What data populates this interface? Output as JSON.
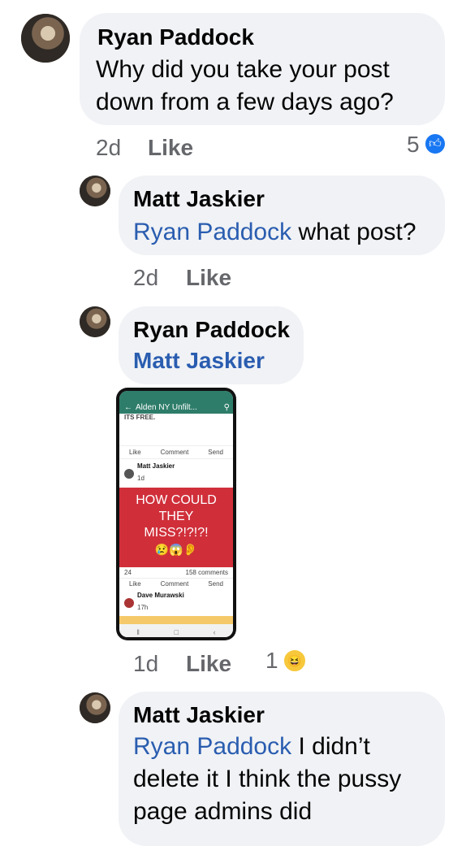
{
  "comments": [
    {
      "author": "Ryan Paddock",
      "text": "Why did you take your post down from a few days ago?",
      "age": "2d",
      "like_label": "Like",
      "reaction_count": "5",
      "reaction_icon": "like-thumb-icon"
    },
    {
      "author": "Matt Jaskier",
      "mention": "Ryan Paddock",
      "text": "what post?",
      "age": "2d",
      "like_label": "Like"
    },
    {
      "author": "Ryan Paddock",
      "mention": "Matt Jaskier",
      "age": "1d",
      "like_label": "Like",
      "reaction_count": "1",
      "reaction_icon": "haha-icon",
      "attachment": {
        "group_title": "Alden NY Unfilt...",
        "top_text": "ITS FREE.",
        "actions": [
          "Like",
          "Comment",
          "Send"
        ],
        "post_author": "Matt Jaskier",
        "post_age": "1d",
        "post_text": "HOW COULD THEY MISS?!?!?!",
        "reactions_count": "24",
        "comments_count": "158 comments",
        "next_author": "Dave Murawski",
        "next_age": "17h"
      }
    },
    {
      "author": "Matt Jaskier",
      "mention": "Ryan Paddock",
      "text": "I didn’t delete it I think the pussy page admins did"
    }
  ],
  "colors": {
    "bubble": "#f0f2f5",
    "mention": "#2a5db0",
    "like_badge": "#1877f2",
    "group_header": "#2e7d6a",
    "post_red": "#d02f3a"
  }
}
